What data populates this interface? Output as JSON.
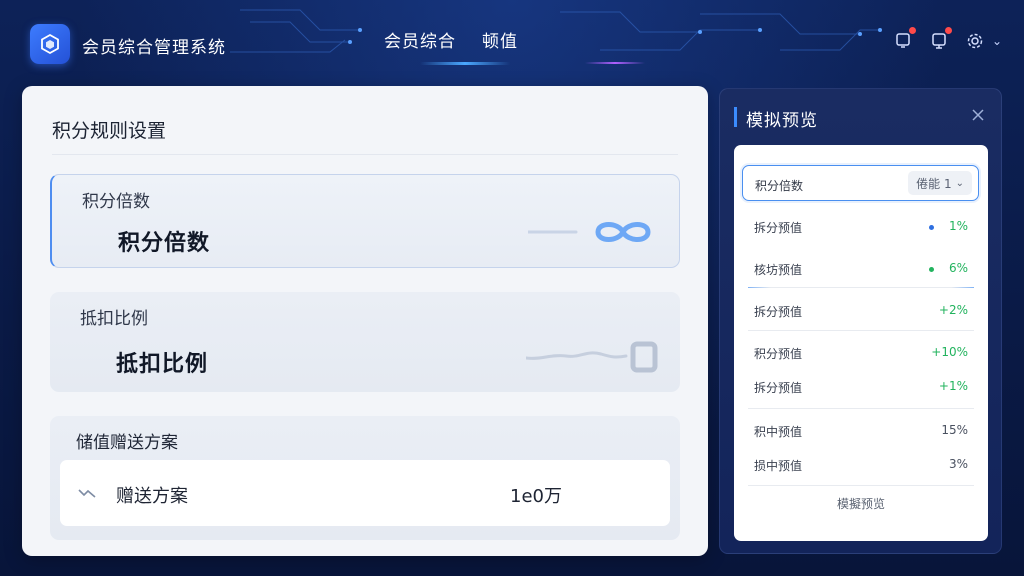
{
  "header": {
    "app_title": "会员综合管理系统",
    "nav": [
      {
        "label": "会员综合"
      },
      {
        "label": "顿值"
      }
    ]
  },
  "icons": {
    "logo": "cube-logo-icon",
    "notification": "bell-icon",
    "message": "message-icon",
    "settings": "gear-icon",
    "dropdown": "chevron-down-icon",
    "close": "close-icon",
    "trend": "trend-icon"
  },
  "colors": {
    "accent": "#3b8cff",
    "badge": "#ff4a4a",
    "positive": "#22b35e",
    "header_bg": "#0b1a45"
  },
  "left_panel": {
    "title": "积分规则设置",
    "cards": [
      {
        "label": "积分倍数",
        "value": "积分倍数"
      },
      {
        "label": "抵扣比例",
        "value": "抵扣比例"
      }
    ],
    "gift_section": {
      "title": "储值赠送方案",
      "item_label": "赠送方案",
      "item_value": "1e0万"
    }
  },
  "right_panel": {
    "title": "模拟预览",
    "select": {
      "label": "积分倍数",
      "value": "倦能 1"
    },
    "rows": [
      {
        "label": "拆分预值",
        "value": "1%",
        "dot_color": "#2f6fe0",
        "value_color": "#22b35e"
      },
      {
        "label": "核坊预值",
        "value": "6%",
        "dot_color": "#22b35e",
        "value_color": "#22b35e"
      },
      {
        "label": "拆分预值",
        "value": "+2%",
        "value_color": "#22b35e"
      },
      {
        "label": "积分预值",
        "value": "+10%",
        "value_color": "#22b35e"
      },
      {
        "label": "拆分预值",
        "value": "+1%",
        "value_color": "#22b35e"
      },
      {
        "label": "积中预值",
        "value": "15%",
        "value_color": "#4a5160"
      },
      {
        "label": "损中预值",
        "value": "3%",
        "value_color": "#4a5160"
      }
    ],
    "footer": "模擬预览"
  }
}
